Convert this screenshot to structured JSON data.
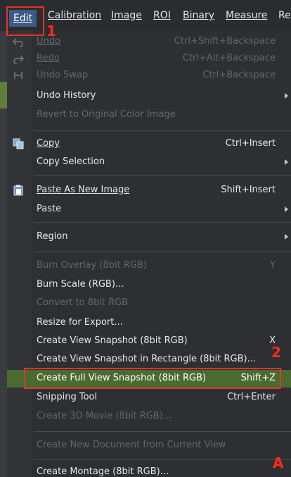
{
  "menubar": {
    "items": [
      {
        "label": "Edit",
        "mnemonic_index": 0
      },
      {
        "label": "Calibration",
        "mnemonic_index": 0
      },
      {
        "label": "Image",
        "mnemonic_index": 0
      },
      {
        "label": "ROI",
        "mnemonic_index": 0
      },
      {
        "label": "Binary",
        "mnemonic_index": 0
      },
      {
        "label": "Measure",
        "mnemonic_index": 0
      },
      {
        "label": "Re"
      }
    ]
  },
  "menu": {
    "undo": {
      "label": "Undo",
      "shortcut": "Ctrl+Shift+Backspace"
    },
    "redo": {
      "label": "Redo",
      "shortcut": "Ctrl+Alt+Backspace"
    },
    "undo_swap": {
      "label": "Undo Swap",
      "shortcut": "Ctrl+Backspace"
    },
    "undo_history": {
      "label": "Undo History"
    },
    "revert": {
      "label": "Revert to Original Color Image"
    },
    "copy": {
      "label": "Copy",
      "shortcut": "Ctrl+Insert"
    },
    "copy_selection": {
      "label": "Copy Selection"
    },
    "paste_new": {
      "label": "Paste As New Image",
      "shortcut": "Shift+Insert"
    },
    "paste": {
      "label": "Paste"
    },
    "region": {
      "label": "Region"
    },
    "burn_overlay": {
      "label": "Burn Overlay (8bit RGB)",
      "shortcut": "Y"
    },
    "burn_scale": {
      "label": "Burn Scale (RGB)..."
    },
    "convert": {
      "label": "Convert to 8bit RGB"
    },
    "resize": {
      "label": "Resize for Export..."
    },
    "view_snapshot": {
      "label": "Create View Snapshot (8bit RGB)",
      "shortcut": "X"
    },
    "view_snapshot_rect": {
      "label": "Create View Snapshot in Rectangle (8bit RGB)..."
    },
    "full_view_snapshot": {
      "label": "Create Full View Snapshot (8bit RGB)",
      "shortcut": "Shift+Z"
    },
    "snipping": {
      "label": "Snipping Tool",
      "shortcut": "Ctrl+Enter"
    },
    "movie": {
      "label": "Create 3D Movie (8bit RGB)..."
    },
    "new_doc": {
      "label": "Create New Document from Current View"
    },
    "montage": {
      "label": "Create Montage (8bit RGB)..."
    }
  },
  "annotations": {
    "step1": "1",
    "step2": "2",
    "corner": "A"
  },
  "colors": {
    "highlight": "#4a6b2f",
    "annotation": "#e8322c",
    "disabled_text": "#66676a"
  }
}
